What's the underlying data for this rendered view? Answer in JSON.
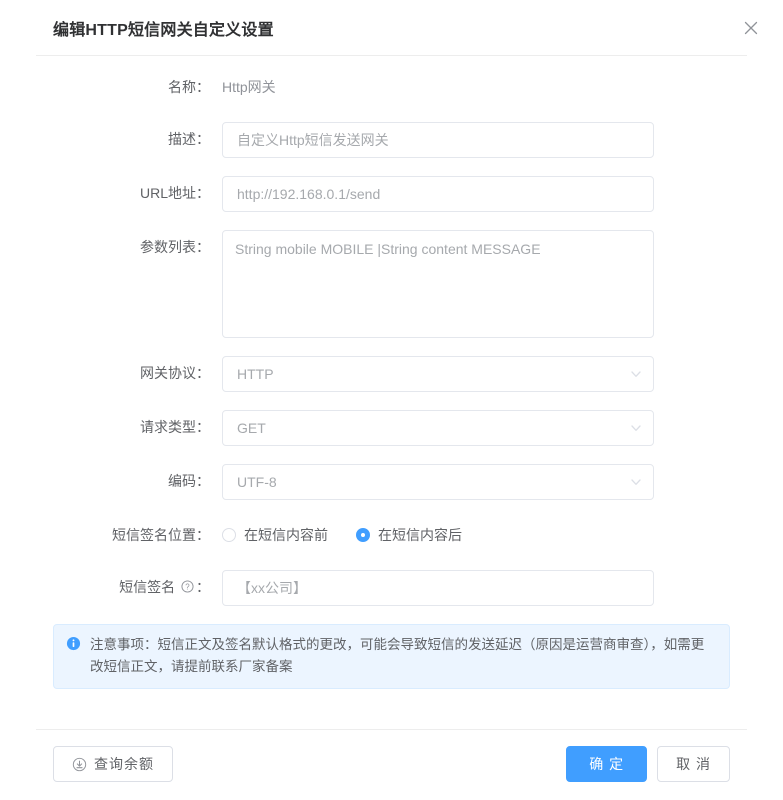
{
  "dialog": {
    "title": "编辑HTTP短信网关自定义设置",
    "close_icon": "close-icon"
  },
  "form": {
    "name": {
      "label": "名称：",
      "value": "Http网关"
    },
    "description": {
      "label": "描述：",
      "value": "自定义Http短信发送网关"
    },
    "url": {
      "label": "URL地址：",
      "value": "http://192.168.0.1/send"
    },
    "params": {
      "label": "参数列表：",
      "value": "String mobile MOBILE |String content MESSAGE"
    },
    "protocol": {
      "label": "网关协议：",
      "value": "HTTP",
      "caret_icon": "chevron-down-icon"
    },
    "method": {
      "label": "请求类型：",
      "value": "GET",
      "caret_icon": "chevron-down-icon"
    },
    "encoding": {
      "label": "编码：",
      "value": "UTF-8",
      "caret_icon": "chevron-down-icon"
    },
    "signature_position": {
      "label": "短信签名位置：",
      "options": [
        {
          "label": "在短信内容前",
          "checked": false
        },
        {
          "label": "在短信内容后",
          "checked": true
        }
      ]
    },
    "signature": {
      "label_prefix": "短信签名 ",
      "label_suffix": "：",
      "help_icon": "help-circle-icon",
      "value": "【xx公司】"
    }
  },
  "alert": {
    "icon": "info-circle-icon",
    "text": "注意事项：短信正文及签名默认格式的更改，可能会导致短信的发送延迟（原因是运营商审查），如需更改短信正文，请提前联系厂家备案"
  },
  "footer": {
    "balance_button": {
      "label": "查询余额",
      "icon": "download-circle-icon"
    },
    "confirm_button": "确 定",
    "cancel_button": "取 消"
  },
  "colors": {
    "accent": "#409eff",
    "alert_bg": "#ecf5ff",
    "alert_border": "#d9ecff",
    "border": "#e4e7ed",
    "text": "#606266",
    "title": "#303133",
    "placeholder": "#a6a9ad"
  }
}
